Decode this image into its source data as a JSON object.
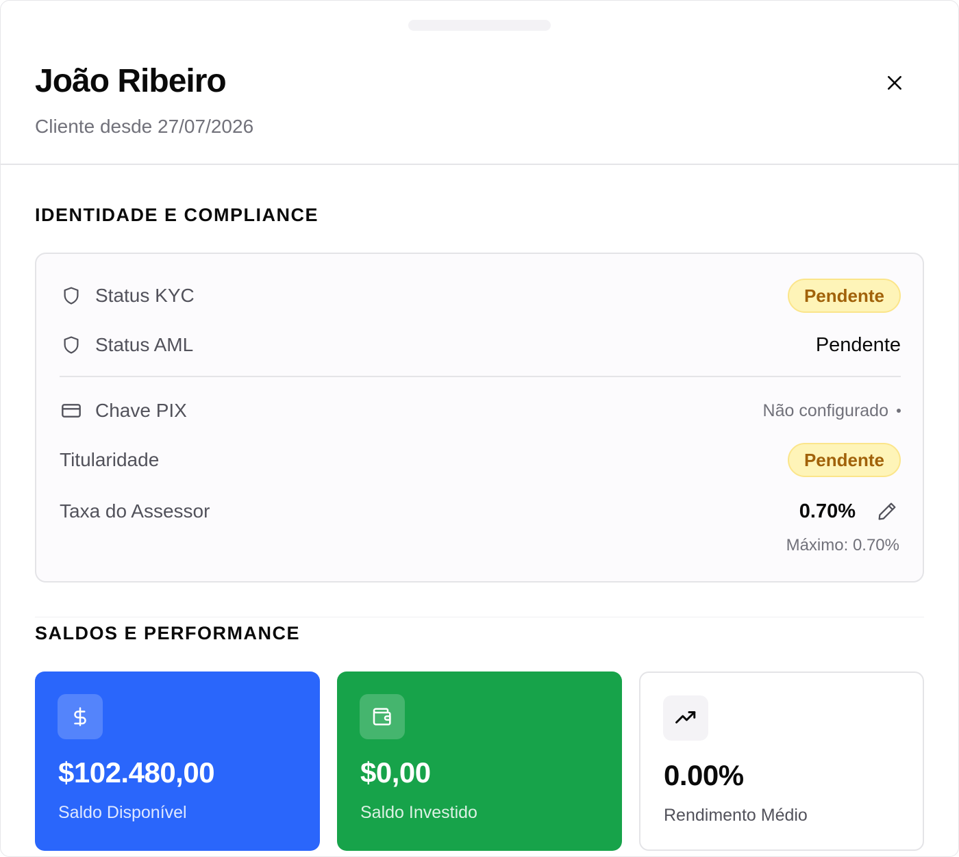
{
  "header": {
    "client_name": "João Ribeiro",
    "client_since": "Cliente desde 27/07/2026"
  },
  "icons": {
    "close": "close-icon",
    "kyc": "shield-icon",
    "aml": "shield-icon",
    "pix": "credit-card-icon",
    "edit": "pencil-icon",
    "available": "dollar-icon",
    "invested": "wallet-icon",
    "yield": "trending-up-icon"
  },
  "identity": {
    "title": "IDENTIDADE E COMPLIANCE",
    "kyc": {
      "label": "Status KYC",
      "value": "Pendente"
    },
    "aml": {
      "label": "Status AML",
      "value": "Pendente"
    },
    "pix": {
      "label": "Chave PIX",
      "value": "Não configurado"
    },
    "ownership": {
      "label": "Titularidade",
      "value": "Pendente"
    },
    "advisor_fee": {
      "label": "Taxa do Assessor",
      "value": "0.70%",
      "max": "Máximo: 0.70%"
    }
  },
  "balances": {
    "title": "SALDOS E PERFORMANCE",
    "available": {
      "value": "$102.480,00",
      "label": "Saldo Disponível"
    },
    "invested": {
      "value": "$0,00",
      "label": "Saldo Investido"
    },
    "yield": {
      "value": "0.00%",
      "label": "Rendimento Médio"
    }
  },
  "colors": {
    "available_card": "#2a66fb",
    "invested_card": "#17a34a",
    "pending_badge_bg": "#fef4b8",
    "pending_badge_text": "#a1620a"
  }
}
